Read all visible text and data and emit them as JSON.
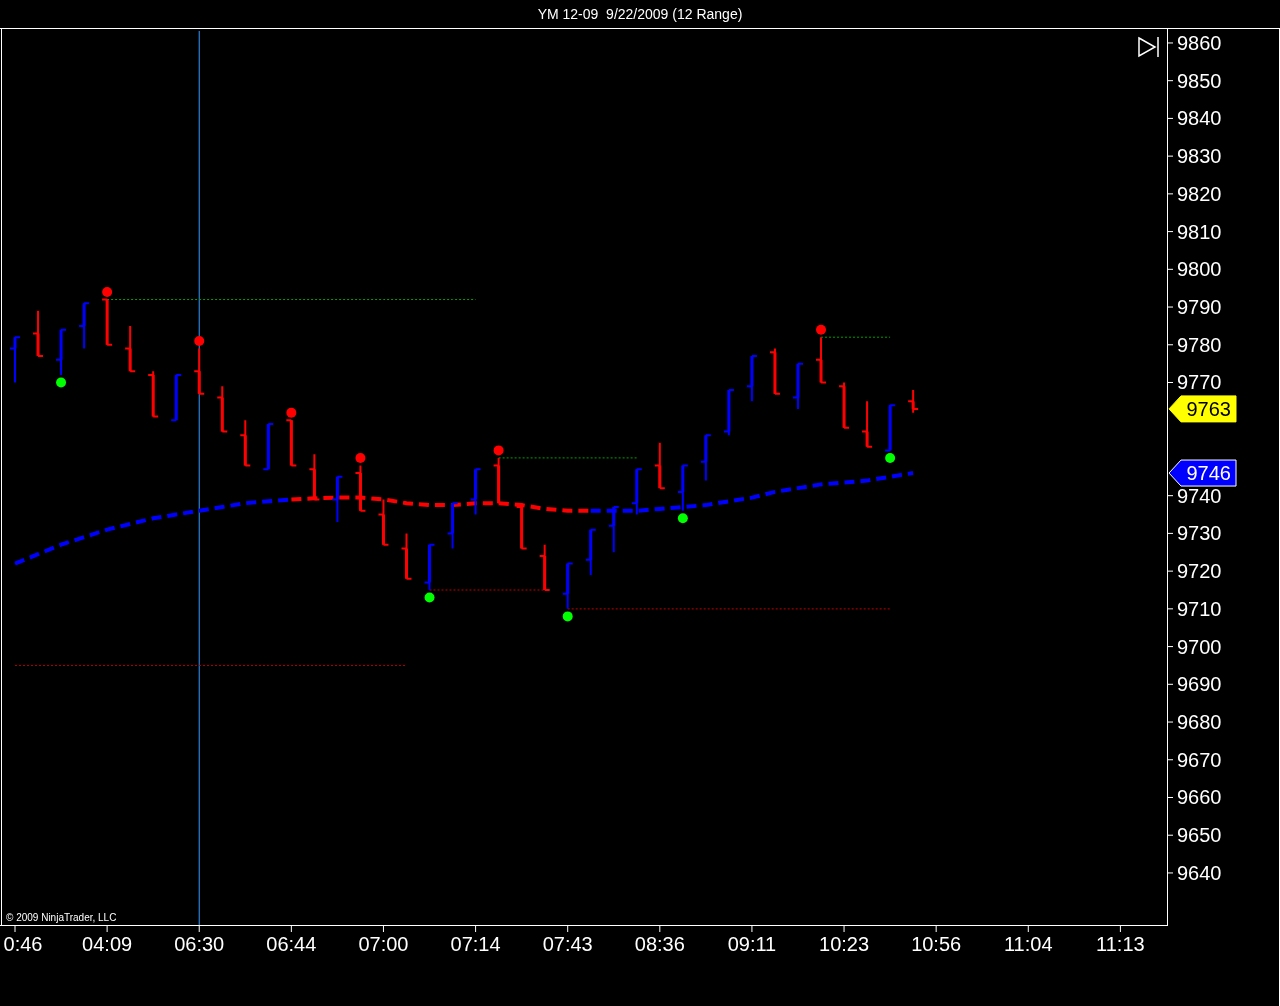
{
  "window": {
    "title": "YM 12-09  9/22/2009 (12 Range)"
  },
  "chart": {
    "copyright": "© 2009 NinjaTrader, LLC",
    "price_markers": [
      {
        "color": "#ffff00"
      },
      {
        "color": "#0000ff"
      }
    ],
    "chart_data": {
      "type": "candlestick",
      "ylim": [
        9626.2,
        9863.7
      ],
      "yticks": [
        9640,
        9650,
        9660,
        9670,
        9680,
        9690,
        9700,
        9710,
        9720,
        9730,
        9740,
        9770,
        9780,
        9790,
        9800,
        9810,
        9820,
        9830,
        9840,
        9850,
        9860
      ],
      "categories": [
        "0:46",
        null,
        null,
        null,
        "04:09",
        null,
        null,
        null,
        "06:30",
        null,
        null,
        null,
        "06:44",
        null,
        null,
        null,
        "07:00",
        null,
        null,
        null,
        "07:14",
        null,
        null,
        null,
        "07:43",
        null,
        null,
        null,
        "08:36",
        null,
        null,
        null,
        "09:11",
        null,
        null,
        null,
        "10:23",
        null,
        null,
        null,
        "10:56",
        null,
        null,
        null,
        "11:04",
        null,
        null,
        null,
        "11:13"
      ],
      "series": [
        {
          "color": "#0000ff",
          "ohlc": [
            [
              9779,
              9782,
              9770,
              9782
            ],
            null,
            [
              9776,
              9784,
              9772,
              9784
            ],
            [
              9785,
              9791,
              9779,
              9791
            ],
            null,
            null,
            null,
            [
              9760,
              9772,
              9760,
              9772
            ],
            null,
            null,
            null,
            [
              9747,
              9759,
              9747,
              9759
            ],
            null,
            null,
            [
              9739,
              9745,
              9733,
              9745
            ],
            null,
            null,
            null,
            [
              9717,
              9727,
              9715,
              9727
            ],
            [
              9730,
              9738,
              9726,
              9738
            ],
            [
              9739,
              9747,
              9735,
              9747
            ],
            null,
            null,
            null,
            [
              9714,
              9722,
              9710,
              9722
            ],
            [
              9723,
              9731,
              9719,
              9731
            ],
            [
              9732,
              9737,
              9725,
              9737
            ],
            [
              9738,
              9747,
              9735,
              9747
            ],
            null,
            [
              9741,
              9748,
              9736,
              9748
            ],
            [
              9749,
              9756,
              9744,
              9756
            ],
            [
              9757,
              9768,
              9756,
              9768
            ],
            [
              9769,
              9777,
              9765,
              9777
            ],
            null,
            [
              9766,
              9775,
              9763,
              9775
            ],
            null,
            null,
            null,
            [
              9752,
              9764,
              9752,
              9764
            ],
            null,
            null,
            null,
            null,
            null,
            null,
            null,
            null,
            null,
            null
          ]
        },
        {
          "color": "#ff0000",
          "ohlc": [
            null,
            [
              9783,
              9789,
              9777,
              9777
            ],
            null,
            null,
            [
              9792,
              9792,
              9780,
              9780
            ],
            [
              9779,
              9785,
              9773,
              9773
            ],
            [
              9772,
              9773,
              9761,
              9761
            ],
            null,
            [
              9773,
              9779,
              9767,
              9767
            ],
            [
              9766,
              9769,
              9757,
              9757
            ],
            [
              9756,
              9760,
              9748,
              9748
            ],
            null,
            [
              9760,
              9760,
              9748,
              9748
            ],
            [
              9747,
              9751,
              9739,
              9739
            ],
            null,
            [
              9746,
              9748,
              9736,
              9736
            ],
            [
              9735,
              9739,
              9727,
              9727
            ],
            [
              9726,
              9730,
              9718,
              9718
            ],
            null,
            null,
            null,
            [
              9748,
              9750,
              9738,
              9738
            ],
            [
              9737,
              9738,
              9726,
              9726
            ],
            [
              9724,
              9727,
              9715,
              9715
            ],
            null,
            null,
            null,
            null,
            [
              9748,
              9754,
              9742,
              9742
            ],
            null,
            null,
            null,
            null,
            [
              9778,
              9779,
              9767,
              9767
            ],
            null,
            [
              9776,
              9782,
              9770,
              9770
            ],
            [
              9769,
              9770,
              9758,
              9758
            ],
            [
              9757,
              9765,
              9753,
              9753
            ],
            null,
            [
              9765,
              9768,
              9762,
              9763
            ],
            null,
            null,
            null,
            null,
            null,
            null,
            null,
            null,
            null
          ]
        },
        {
          "type": "line",
          "color": "#0000ff",
          "line_style": "dashed",
          "values": [
            9722,
            9724.5,
            9727,
            9729,
            9731,
            9732.5,
            9734,
            9735,
            9736,
            9737,
            9738,
            9738.5,
            9739,
            null,
            null,
            null,
            null,
            null,
            null,
            null,
            null,
            null,
            null,
            null,
            null,
            9736,
            9736,
            9736,
            9736.5,
            9737,
            9737.5,
            9738.5,
            9739.5,
            9741,
            9742,
            9743,
            9743.5,
            9744,
            9745,
            9746,
            null,
            null,
            null,
            null,
            null,
            null,
            null,
            null,
            null
          ]
        },
        {
          "type": "line",
          "color": "#ff0000",
          "line_style": "dashed",
          "values": [
            null,
            null,
            null,
            null,
            null,
            null,
            null,
            null,
            null,
            null,
            null,
            null,
            9739,
            9739.3,
            9739.5,
            9739.5,
            9739,
            9738,
            9737.5,
            9737.5,
            9738,
            9738,
            9737.5,
            9736.5,
            9736,
            9736,
            null,
            null,
            null,
            null,
            null,
            null,
            null,
            null,
            null,
            null,
            null,
            null,
            null,
            null,
            null,
            null,
            null,
            null,
            null,
            null,
            null,
            null,
            null
          ]
        },
        {
          "type": "line",
          "color": "#00a000",
          "line_style": "dotted",
          "values": [
            null,
            null,
            null,
            null,
            9792,
            9792,
            9792,
            9792,
            9792,
            9792,
            9792,
            9792,
            9792,
            9792,
            9792,
            9792,
            9792,
            9792,
            9792,
            9792,
            9792,
            null,
            null,
            null,
            null,
            null,
            null,
            null,
            null,
            null,
            null,
            null,
            null,
            null,
            null,
            null,
            null,
            null,
            null,
            null,
            null,
            null,
            null,
            null,
            null,
            null,
            null,
            null,
            null
          ]
        },
        {
          "type": "line",
          "color": "#c00000",
          "line_style": "dotted",
          "values": [
            9695,
            9695,
            9695,
            9695,
            9695,
            9695,
            9695,
            9695,
            9695,
            9695,
            9695,
            9695,
            9695,
            9695,
            9695,
            9695,
            9695,
            9695,
            null,
            null,
            null,
            null,
            null,
            null,
            null,
            null,
            null,
            null,
            null,
            null,
            null,
            null,
            null,
            null,
            null,
            null,
            null,
            null,
            null,
            null,
            null,
            null,
            null,
            null,
            null,
            null,
            null,
            null,
            null
          ]
        },
        {
          "type": "line",
          "color": "#00a000",
          "line_style": "dotted",
          "values": [
            null,
            null,
            null,
            null,
            null,
            null,
            null,
            null,
            null,
            null,
            null,
            null,
            null,
            null,
            null,
            null,
            null,
            null,
            null,
            null,
            null,
            9750,
            9750,
            9750,
            9750,
            9750,
            9750,
            9750,
            null,
            null,
            null,
            null,
            null,
            null,
            null,
            null,
            null,
            null,
            null,
            null,
            null,
            null,
            null,
            null,
            null,
            null,
            null,
            null,
            null
          ]
        },
        {
          "type": "line",
          "color": "#c00000",
          "line_style": "dotted",
          "values": [
            null,
            null,
            null,
            null,
            null,
            null,
            null,
            null,
            null,
            null,
            null,
            null,
            null,
            null,
            null,
            null,
            null,
            null,
            9715,
            9715,
            9715,
            9715,
            9715,
            9715,
            null,
            null,
            null,
            null,
            null,
            null,
            null,
            null,
            null,
            null,
            null,
            null,
            null,
            null,
            null,
            null,
            null,
            null,
            null,
            null,
            null,
            null,
            null,
            null,
            null
          ]
        },
        {
          "type": "line",
          "color": "#c00000",
          "line_style": "dotted",
          "values": [
            null,
            null,
            null,
            null,
            null,
            null,
            null,
            null,
            null,
            null,
            null,
            null,
            null,
            null,
            null,
            null,
            null,
            null,
            null,
            null,
            null,
            null,
            null,
            null,
            9710,
            9710,
            9710,
            9710,
            9710,
            9710,
            9710,
            9710,
            9710,
            9710,
            9710,
            9710,
            9710,
            9710,
            9710,
            null,
            null,
            null,
            null,
            null,
            null,
            null,
            null,
            null,
            null
          ]
        },
        {
          "type": "line",
          "color": "#00a000",
          "line_style": "dotted",
          "values": [
            null,
            null,
            null,
            null,
            null,
            null,
            null,
            null,
            null,
            null,
            null,
            null,
            null,
            null,
            null,
            null,
            null,
            null,
            null,
            null,
            null,
            null,
            null,
            null,
            null,
            null,
            null,
            null,
            null,
            null,
            null,
            null,
            null,
            null,
            null,
            9782,
            9782,
            9782,
            9782,
            null,
            null,
            null,
            null,
            null,
            null,
            null,
            null,
            null,
            null
          ]
        },
        {
          "type": "scatter",
          "color": "#ff0000",
          "values": [
            null,
            null,
            null,
            null,
            9794,
            null,
            null,
            null,
            9781,
            null,
            null,
            null,
            9762,
            null,
            null,
            9750,
            null,
            null,
            null,
            null,
            null,
            9752,
            null,
            null,
            null,
            null,
            null,
            null,
            null,
            null,
            null,
            null,
            null,
            null,
            null,
            9784,
            null,
            null,
            null,
            null,
            null,
            null,
            null,
            null,
            null,
            null,
            null,
            null,
            null
          ]
        },
        {
          "type": "scatter",
          "color": "#00ff00",
          "values": [
            null,
            null,
            9770,
            null,
            null,
            null,
            null,
            null,
            null,
            null,
            null,
            null,
            null,
            null,
            null,
            null,
            null,
            null,
            9713,
            null,
            null,
            null,
            null,
            null,
            9708,
            null,
            null,
            null,
            null,
            9734,
            null,
            null,
            null,
            null,
            null,
            null,
            null,
            null,
            9750,
            null,
            null,
            null,
            null,
            null,
            null,
            null,
            null,
            null,
            null
          ]
        }
      ],
      "ref_lines": [
        {
          "axis": "x",
          "value": "06:30",
          "color": "#3399ff"
        }
      ],
      "annotations": [
        "9763",
        "9746"
      ]
    }
  }
}
